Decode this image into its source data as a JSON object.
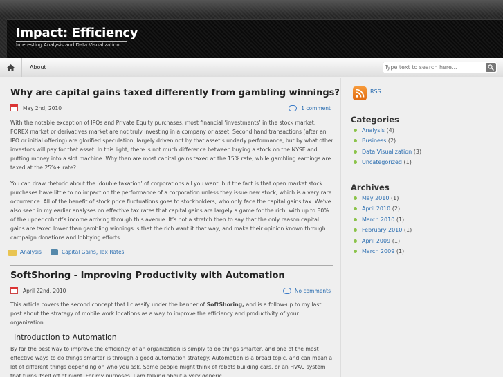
{
  "header": {
    "site_title": "Impact: Efficiency",
    "site_description": "Interesting Analysis and Data Visualization"
  },
  "nav": {
    "home_icon": "home-icon",
    "items": [
      {
        "label": "About"
      }
    ]
  },
  "search": {
    "placeholder": "Type text to search here..."
  },
  "posts": [
    {
      "title": "Why are capital gains taxed differently from gambling winnings?",
      "date": "May 2nd, 2010",
      "comments": "1 comment",
      "paragraphs": [
        "With the notable exception of IPOs and Private Equity purchases, most financial ‘investments’ in the stock market, FOREX market or derivatives market are not truly investing in a company or asset. Second hand transactions (after an IPO or initial offering) are glorified speculation, largely driven not by that asset’s underly performance, but by what other investors will pay for that asset. In this light, there is not much difference between buying a stock on the NYSE and putting money into a slot machine. Why then are most capital gains taxed at the 15% rate, while gambling earnings are taxed at the 25%+ rate?",
        "You can draw rhetoric about the ‘double taxation’ of corporations all you want, but the fact is that open market stock purchases have little to no impact on the performance of a corporation unless they issue new stock, which is a very rare occurrence. All of the benefit of stock price fluctuations goes to stockholders, who only face the capital gains tax. We’ve also seen in my earlier analyses on effective tax rates that capital gains are largely a game for the rich, with up to 80% of the upper cohort’s income arriving through this avenue. It’s not a stretch then to say that the only reason capital gains are taxed lower than gambling winnings is that the rich want it that way, and make their opinion known through campaign donations and lobbying efforts."
      ],
      "category": "Analysis",
      "tags": "Capital Gains, Tax Rates"
    },
    {
      "title": "SoftShoring - Improving Productivity with Automation",
      "date": "April 22nd, 2010",
      "comments": "No comments",
      "intro_before": "This article covers the second concept that I classify under the banner of ",
      "intro_bold": "SoftShoring,",
      "intro_after": " and is a follow-up to my last post about the strategy of mobile work locations as a way to improve the efficiency and productivity of your organization.",
      "subheading": "Introduction to Automation",
      "paragraph": "By far the best way to improve the efficiency of an organization is simply to do things smarter, and one of the most effective ways to do things smarter is through a good automation strategy. Automation is a broad topic, and can mean a lot of different things depending on who you ask. Some people might think of robots building cars, or an HVAC system that turns itself off at night. For my purposes, I am talking about a very generic"
    }
  ],
  "sidebar": {
    "rss_label": "RSS",
    "categories_title": "Categories",
    "categories": [
      {
        "name": "Analysis",
        "count": "(4)"
      },
      {
        "name": "Business",
        "count": "(2)"
      },
      {
        "name": "Data Visualization",
        "count": "(3)"
      },
      {
        "name": "Uncategorized",
        "count": "(1)"
      }
    ],
    "archives_title": "Archives",
    "archives": [
      {
        "name": "May 2010",
        "count": "(1)"
      },
      {
        "name": "April 2010",
        "count": "(2)"
      },
      {
        "name": "March 2010",
        "count": "(1)"
      },
      {
        "name": "February 2010",
        "count": "(1)"
      },
      {
        "name": "April 2009",
        "count": "(1)"
      },
      {
        "name": "March 2009",
        "count": "(1)"
      }
    ]
  }
}
